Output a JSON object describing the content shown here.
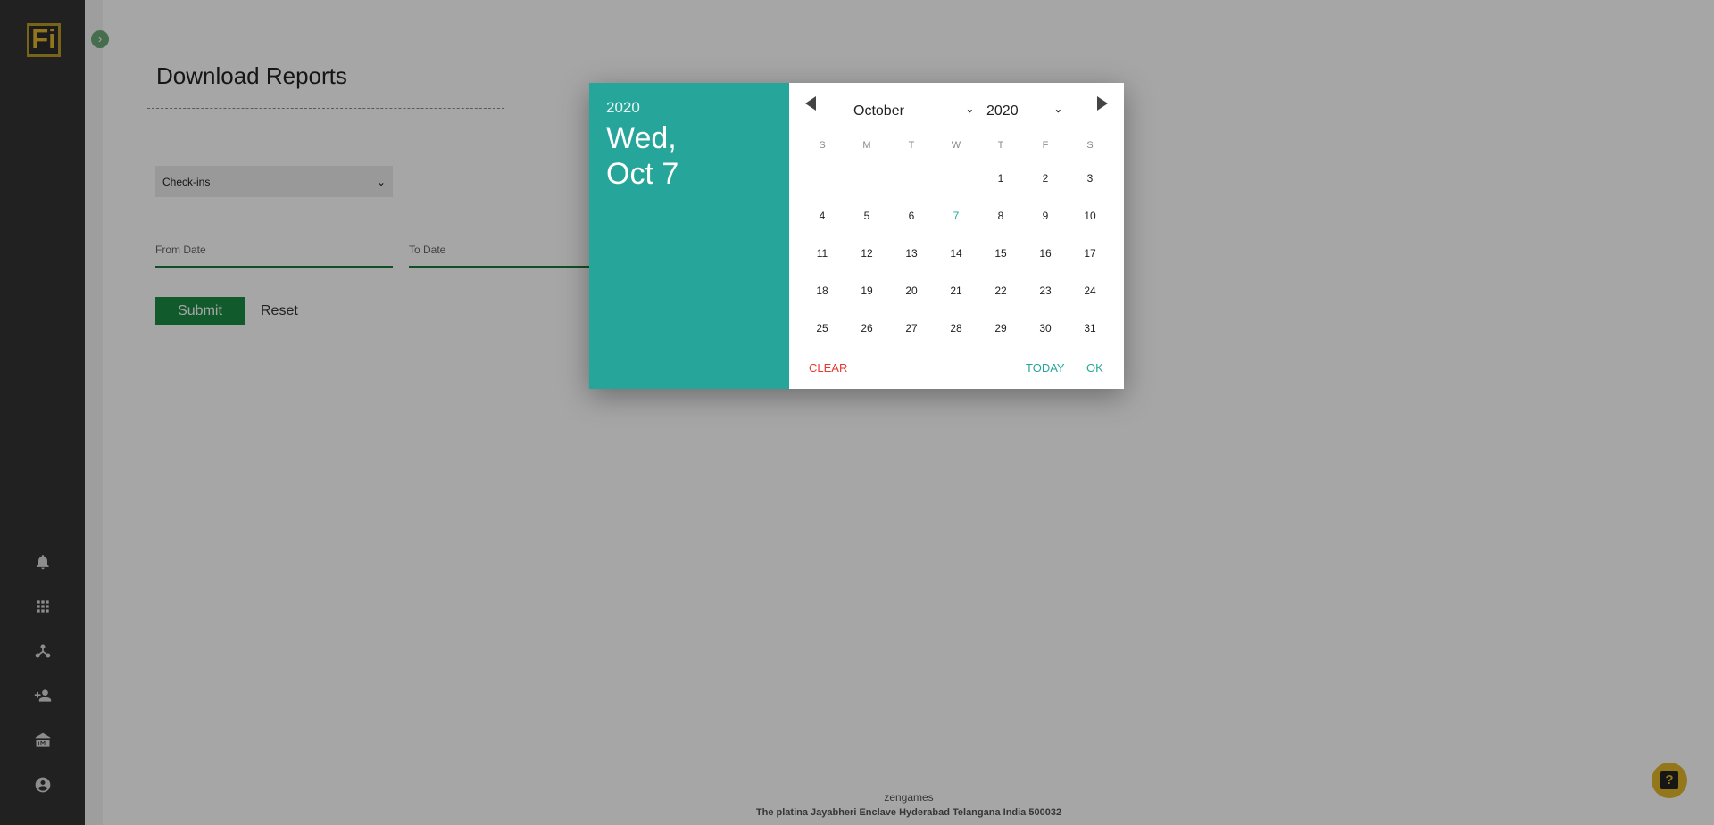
{
  "sidebar": {
    "logo": "Fi",
    "icons": [
      "bell-icon",
      "apps-grid-icon",
      "network-icon",
      "add-user-icon",
      "institution-icon",
      "account-icon"
    ]
  },
  "main": {
    "title": "Download Reports",
    "report_type": "Check-ins",
    "from_date_label": "From Date",
    "to_date_label": "To Date",
    "submit_label": "Submit",
    "reset_label": "Reset"
  },
  "footer": {
    "company": "zengames",
    "address": "The platina Jayabheri Enclave Hyderabad Telangana India 500032"
  },
  "picker": {
    "header_year": "2020",
    "header_day": "Wed,",
    "header_date": "Oct 7",
    "month": "October",
    "year": "2020",
    "weekdays": [
      "S",
      "M",
      "T",
      "W",
      "T",
      "F",
      "S"
    ],
    "leading_blanks": 4,
    "days": [
      "1",
      "2",
      "3",
      "4",
      "5",
      "6",
      "7",
      "8",
      "9",
      "10",
      "11",
      "12",
      "13",
      "14",
      "15",
      "16",
      "17",
      "18",
      "19",
      "20",
      "21",
      "22",
      "23",
      "24",
      "25",
      "26",
      "27",
      "28",
      "29",
      "30",
      "31"
    ],
    "selected_day": "7",
    "clear_label": "CLEAR",
    "today_label": "TODAY",
    "ok_label": "OK"
  },
  "colors": {
    "accent": "#26a69a",
    "submit": "#1a8a42",
    "clear": "#e53935",
    "logo": "#e0b52e"
  }
}
